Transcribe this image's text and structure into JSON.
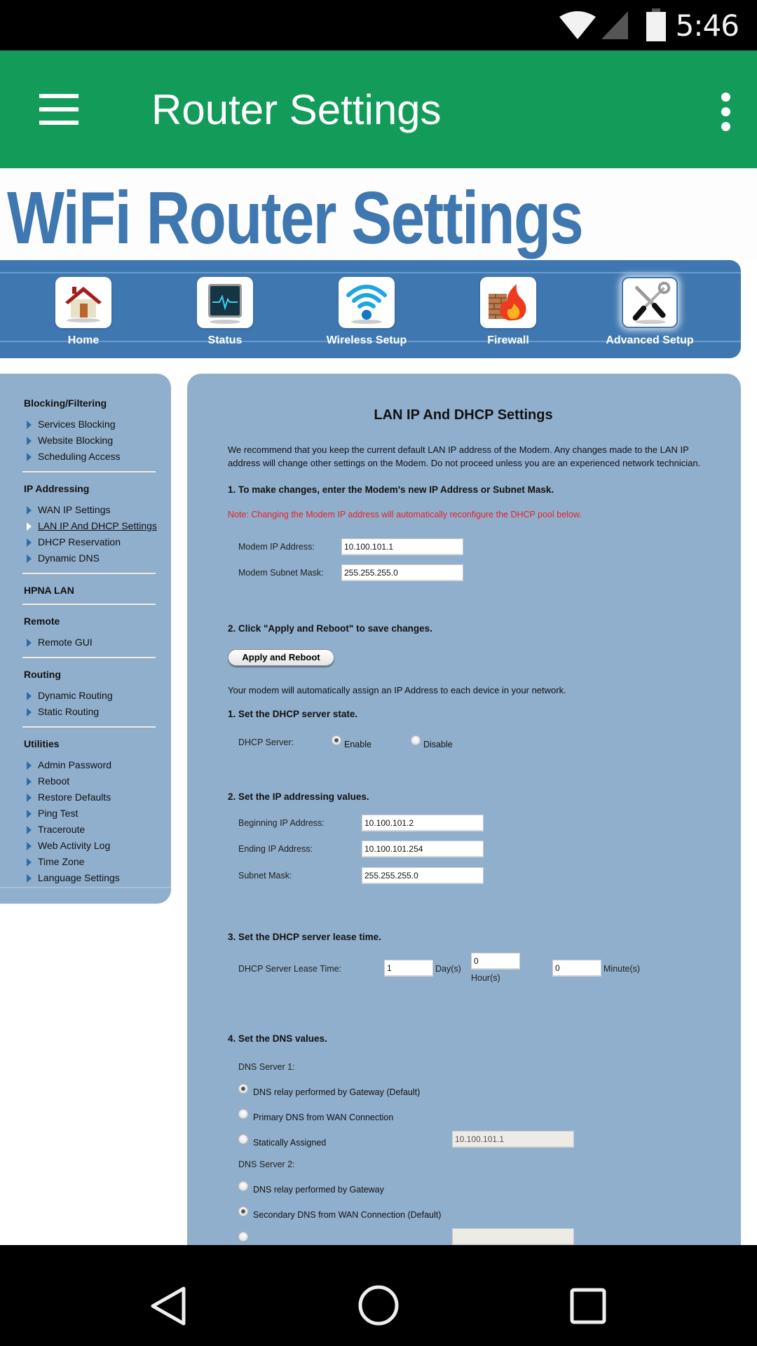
{
  "status_bar": {
    "time": "5:46",
    "icons": [
      "wifi-icon",
      "cell-signal-icon",
      "battery-icon"
    ]
  },
  "app_bar": {
    "title": "Router Settings",
    "menu_icon": "hamburger-menu-icon",
    "overflow_icon": "more-vert-icon"
  },
  "banner": {
    "logo_text": "WiFi Router Settings",
    "brand_color": "#3f77b0"
  },
  "top_nav": {
    "items": [
      {
        "label": "Home",
        "icon": "house-icon"
      },
      {
        "label": "Status",
        "icon": "monitor-pulse-icon"
      },
      {
        "label": "Wireless Setup",
        "icon": "wifi-signal-icon"
      },
      {
        "label": "Firewall",
        "icon": "firewall-flame-icon"
      },
      {
        "label": "Advanced Setup",
        "icon": "tools-icon",
        "active": true
      }
    ]
  },
  "sidebar": {
    "groups": [
      {
        "heading": "Blocking/Filtering",
        "items": [
          "Services Blocking",
          "Website Blocking",
          "Scheduling Access"
        ]
      },
      {
        "heading": "IP Addressing",
        "items": [
          "WAN IP Settings",
          "LAN IP And DHCP Settings",
          "DHCP Reservation",
          "Dynamic DNS"
        ],
        "active_item": "LAN IP And DHCP Settings"
      },
      {
        "heading": "HPNA LAN",
        "items": []
      },
      {
        "heading": "Remote",
        "items": [
          "Remote GUI"
        ]
      },
      {
        "heading": "Routing",
        "items": [
          "Dynamic Routing",
          "Static Routing"
        ]
      },
      {
        "heading": "Utilities",
        "items": [
          "Admin Password",
          "Reboot",
          "Restore Defaults",
          "Ping Test",
          "Traceroute",
          "Web Activity Log",
          "Time Zone",
          "Language Settings"
        ]
      }
    ]
  },
  "main": {
    "title": "LAN IP And DHCP Settings",
    "intro_line1": "We recommend that you keep the current default LAN IP address of the Modem. Any changes made to the LAN IP",
    "intro_line2": "address will change other settings on the Modem. Do not proceed unless you are an experienced network technician.",
    "step1": "1. To make changes, enter the Modem's new IP Address or Subnet Mask.",
    "note": "Note: Changing the Modem IP address will automatically reconfigure the DHCP pool below.",
    "note_color": "#e8202a",
    "modem_ip_label": "Modem IP Address:",
    "modem_ip_value": "10.100.101.1",
    "modem_mask_label": "Modem Subnet Mask:",
    "modem_mask_value": "255.255.255.0",
    "step2": "2. Click \"Apply and Reboot\" to save changes.",
    "apply_button": "Apply and Reboot",
    "dhcp_intro": "Your modem will automatically assign an IP Address to each device in your network.",
    "dhcp_step1": "1. Set the DHCP server state.",
    "dhcp_server_label": "DHCP Server:",
    "dhcp_enable_label": "Enable",
    "dhcp_disable_label": "Disable",
    "dhcp_state": "Enable",
    "dhcp_step2": "2. Set the IP addressing values.",
    "begin_ip_label": "Beginning IP Address:",
    "begin_ip_value": "10.100.101.2",
    "end_ip_label": "Ending IP Address:",
    "end_ip_value": "10.100.101.254",
    "subnet_label": "Subnet Mask:",
    "subnet_value": "255.255.255.0",
    "dhcp_step3": "3. Set the DHCP server lease time.",
    "lease_label": "DHCP Server Lease Time:",
    "lease_days": "1",
    "lease_days_unit": "Day(s)",
    "lease_hours": "0",
    "lease_hours_unit": "Hour(s)",
    "lease_minutes": "0",
    "lease_minutes_unit": "Minute(s)",
    "dhcp_step4": "4. Set the DNS values.",
    "dns1_label": "DNS Server 1:",
    "dns1_options": [
      "DNS relay performed by Gateway (Default)",
      "Primary DNS from WAN Connection",
      "Statically Assigned"
    ],
    "dns1_selected": "DNS relay performed by Gateway (Default)",
    "dns1_static_value": "10.100.101.1",
    "dns2_label": "DNS Server 2:",
    "dns2_options": [
      "DNS relay performed by Gateway",
      "Secondary DNS from WAN Connection (Default)"
    ],
    "dns2_selected": "Secondary DNS from WAN Connection (Default)"
  },
  "nav_bar": {
    "icons": [
      "back-icon",
      "home-icon",
      "recents-icon"
    ]
  }
}
